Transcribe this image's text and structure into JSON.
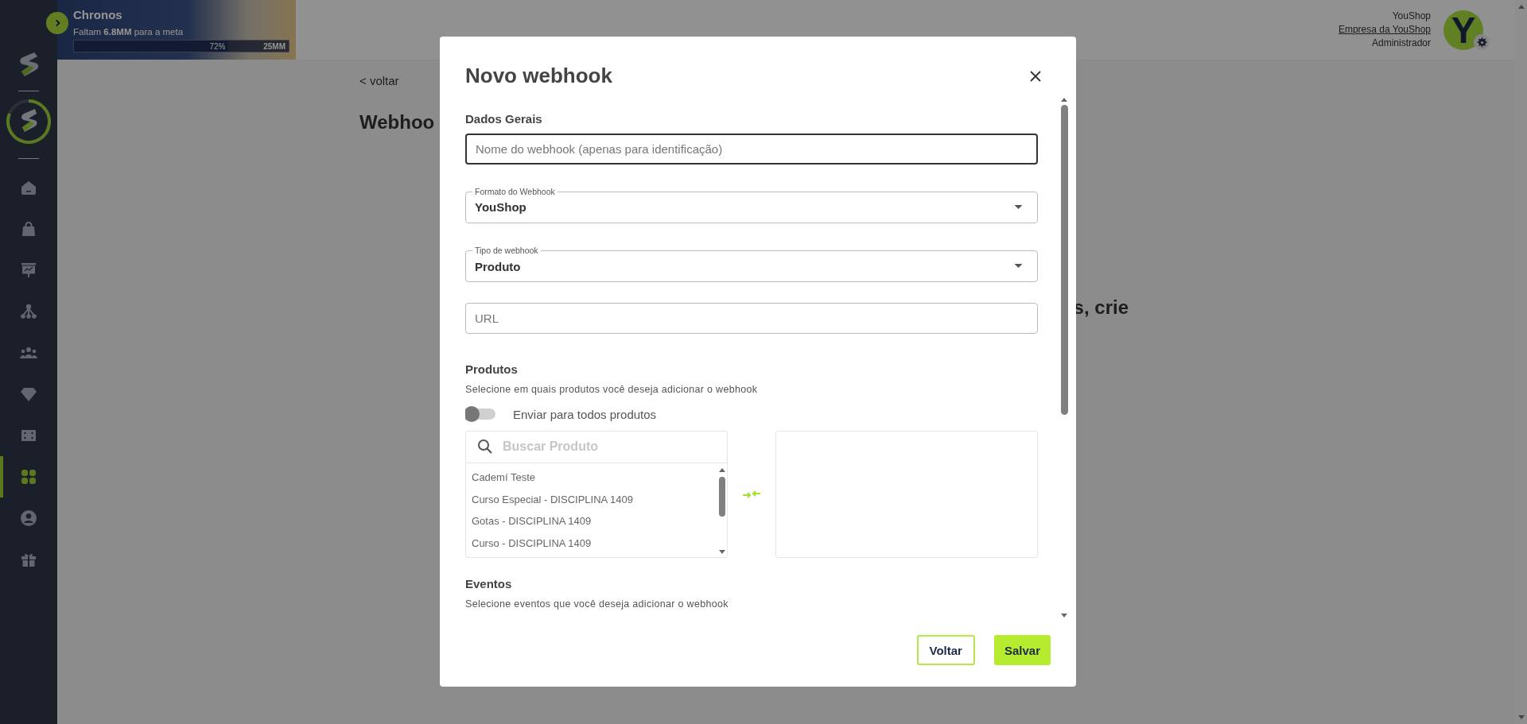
{
  "sidebar": {
    "items": [
      {
        "selected": false
      },
      {
        "selected": false
      },
      {
        "selected": false
      },
      {
        "selected": false
      },
      {
        "selected": false
      },
      {
        "selected": false
      },
      {
        "selected": false
      },
      {
        "selected": true
      },
      {
        "selected": false
      },
      {
        "selected": false
      }
    ]
  },
  "goal_banner": {
    "title": "Chronos",
    "message": "Faltam **6.8MM** para a meta",
    "progress": {
      "level": 0.72,
      "percent": "72%",
      "target": "25MM"
    }
  },
  "account": {
    "name": "YouShop",
    "company": "Empresa da YouShop",
    "role": "Administrador",
    "avatar_letter": "Y"
  },
  "page": {
    "back_link": "< voltar",
    "title": "Webhoo",
    "message_fragment": "s, crie"
  },
  "modal": {
    "title": "Novo webhook",
    "general": {
      "heading": "Dados Gerais",
      "fields": [
        {
          "kind": "text",
          "placeholder": "Nome do webhook (apenas para identificação)",
          "focused": true
        },
        {
          "kind": "select",
          "label": "Formato do Webhook",
          "value": "YouShop"
        },
        {
          "kind": "select",
          "label": "Tipo de webhook",
          "value": "Produto"
        },
        {
          "kind": "text",
          "placeholder": "URL",
          "focused": false
        }
      ]
    },
    "products": {
      "heading": "Produtos",
      "hint": "Selecione em quais produtos você deseja adicionar o webhook",
      "toggle": {
        "label": "Enviar para todos produtos",
        "on": false
      },
      "search": {
        "placeholder": "Buscar Produto"
      },
      "items": [
        "Cademí Teste",
        "Curso Especial - DISCIPLINA 1409",
        "Gotas - DISCIPLINA 1409",
        "Curso - DISCIPLINA 1409"
      ]
    },
    "events": {
      "heading": "Eventos",
      "hint": "Selecione eventos que você deseja adicionar o webhook"
    },
    "buttons": [
      {
        "label": "Voltar",
        "kind": "secondary"
      },
      {
        "label": "Salvar",
        "kind": "primary"
      }
    ]
  }
}
